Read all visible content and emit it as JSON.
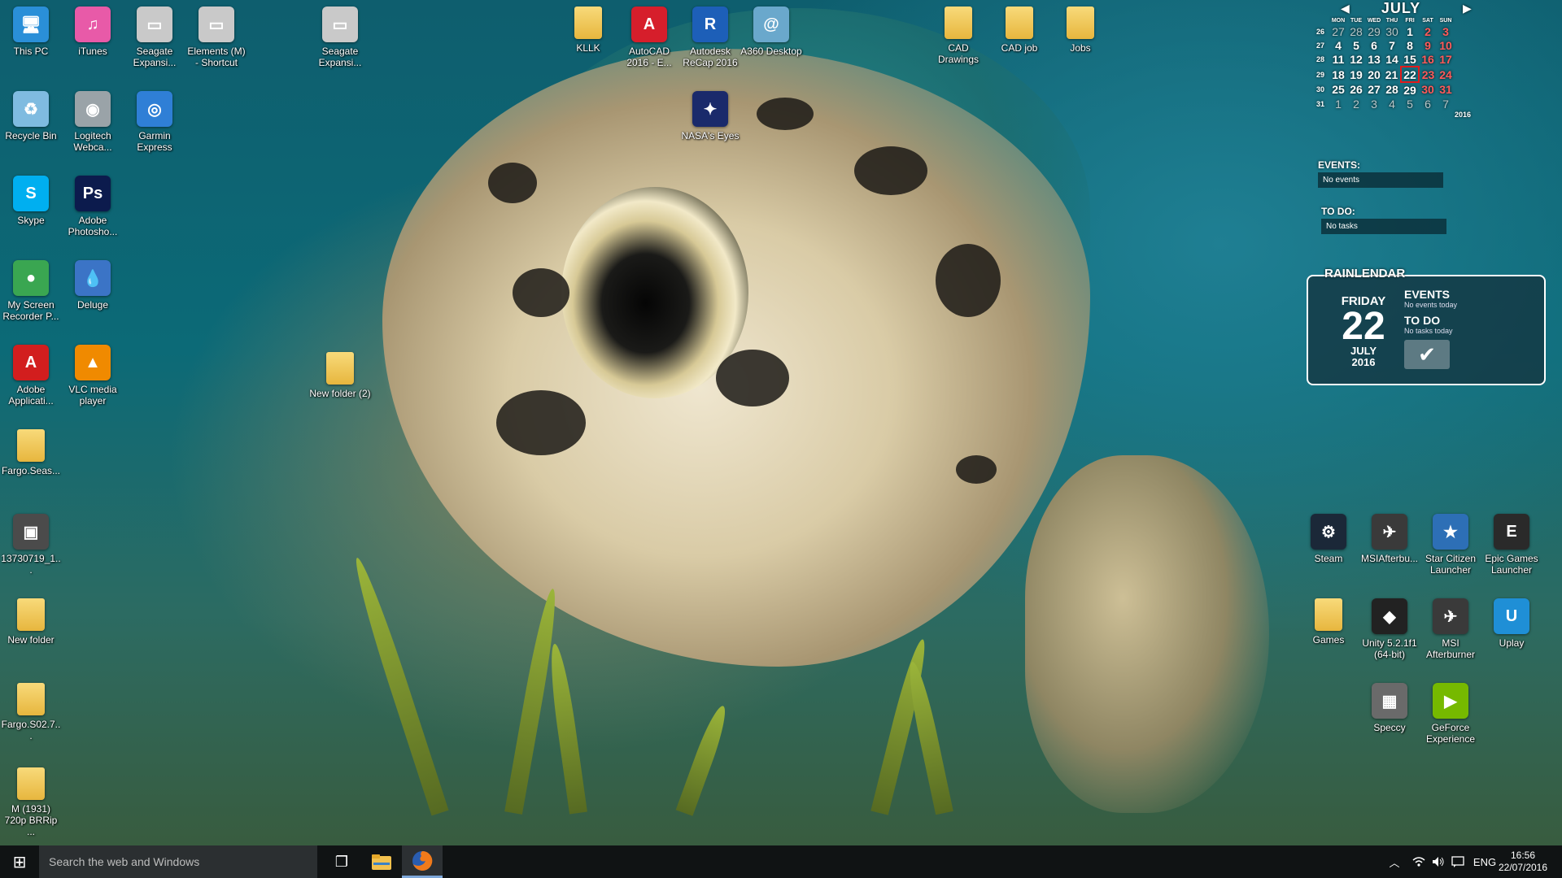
{
  "desktop": {
    "icons": [
      {
        "label": "This PC",
        "icon": "computer-icon",
        "color": "#2a8fd8"
      },
      {
        "label": "iTunes",
        "icon": "itunes-icon",
        "color": "#e85aa8"
      },
      {
        "label": "Seagate Expansi...",
        "icon": "drive-icon",
        "color": "#c9c9c9"
      },
      {
        "label": "Elements (M) - Shortcut",
        "icon": "drive-icon",
        "color": "#c9c9c9"
      },
      {
        "label": "Seagate Expansi...",
        "icon": "drive-icon",
        "color": "#c9c9c9"
      },
      {
        "label": "Recycle Bin",
        "icon": "recycle-bin-icon",
        "color": "#7fbbe0"
      },
      {
        "label": "Logitech Webca...",
        "icon": "webcam-icon",
        "color": "#9aa3a8"
      },
      {
        "label": "Garmin Express",
        "icon": "garmin-icon",
        "color": "#2f7fd6"
      },
      {
        "label": "Skype",
        "icon": "skype-icon",
        "color": "#00aff0"
      },
      {
        "label": "Adobe Photosho...",
        "icon": "photoshop-icon",
        "color": "#0c1b4d"
      },
      {
        "label": "My Screen Recorder P...",
        "icon": "screen-recorder-icon",
        "color": "#3aa651"
      },
      {
        "label": "Deluge",
        "icon": "deluge-icon",
        "color": "#3b74c6"
      },
      {
        "label": "Adobe Applicati...",
        "icon": "adobe-icon",
        "color": "#d21e1e"
      },
      {
        "label": "VLC media player",
        "icon": "vlc-icon",
        "color": "#f08a00"
      },
      {
        "label": "Fargo.Seas...",
        "icon": "folder-icon",
        "color": "#e7b63e"
      },
      {
        "label": "13730719_1...",
        "icon": "image-file-icon",
        "color": "#4b4b4b"
      },
      {
        "label": "New folder",
        "icon": "folder-icon",
        "color": "#e7b63e"
      },
      {
        "label": "Fargo.S02.7...",
        "icon": "folder-icon",
        "color": "#e7b63e"
      },
      {
        "label": "M (1931) 720p BRRip ...",
        "icon": "folder-icon",
        "color": "#f0e2b0"
      },
      {
        "label": "New folder (2)",
        "icon": "folder-icon",
        "color": "#e7b63e"
      },
      {
        "label": "KLLK",
        "icon": "folder-icon",
        "color": "#e7b63e"
      },
      {
        "label": "AutoCAD 2016 - E...",
        "icon": "autocad-icon",
        "color": "#d61e2b"
      },
      {
        "label": "Autodesk ReCap 2016",
        "icon": "recap-icon",
        "color": "#1d5fb8"
      },
      {
        "label": "A360 Desktop",
        "icon": "a360-icon",
        "color": "#6aa8cc"
      },
      {
        "label": "NASA's Eyes",
        "icon": "nasa-eyes-icon",
        "color": "#1a2a6b"
      },
      {
        "label": "CAD Drawings",
        "icon": "folder-icon",
        "color": "#e7b63e"
      },
      {
        "label": "CAD job",
        "icon": "folder-icon",
        "color": "#e7b63e"
      },
      {
        "label": "Jobs",
        "icon": "folder-icon",
        "color": "#e7b63e"
      },
      {
        "label": "Steam",
        "icon": "steam-icon",
        "color": "#1b2838"
      },
      {
        "label": "MSIAfterbu...",
        "icon": "msi-afterburner-icon",
        "color": "#3a3a3a"
      },
      {
        "label": "Star Citizen Launcher",
        "icon": "star-citizen-icon",
        "color": "#2d6fb6"
      },
      {
        "label": "Epic Games Launcher",
        "icon": "epic-games-icon",
        "color": "#2a2a2a"
      },
      {
        "label": "Games",
        "icon": "folder-icon",
        "color": "#e7b63e"
      },
      {
        "label": "Unity 5.2.1f1 (64-bit)",
        "icon": "unity-icon",
        "color": "#222222"
      },
      {
        "label": "MSI Afterburner",
        "icon": "msi-afterburner-icon",
        "color": "#3a3a3a"
      },
      {
        "label": "Uplay",
        "icon": "uplay-icon",
        "color": "#1f8fd6"
      },
      {
        "label": "Speccy",
        "icon": "speccy-icon",
        "color": "#6a6a6a"
      },
      {
        "label": "GeForce Experience",
        "icon": "geforce-icon",
        "color": "#76b900"
      }
    ]
  },
  "calendar": {
    "month": "JULY",
    "prev_glyph": "◀",
    "next_glyph": "▶",
    "weekday_headers": [
      "MON",
      "TUE",
      "WED",
      "THU",
      "FRI",
      "SAT",
      "SUN"
    ],
    "weeks": [
      {
        "wk": "26",
        "days": [
          "27",
          "28",
          "29",
          "30",
          "1",
          "2",
          "3"
        ]
      },
      {
        "wk": "27",
        "days": [
          "4",
          "5",
          "6",
          "7",
          "8",
          "9",
          "10"
        ]
      },
      {
        "wk": "28",
        "days": [
          "11",
          "12",
          "13",
          "14",
          "15",
          "16",
          "17"
        ]
      },
      {
        "wk": "29",
        "days": [
          "18",
          "19",
          "20",
          "21",
          "22",
          "23",
          "24"
        ]
      },
      {
        "wk": "30",
        "days": [
          "25",
          "26",
          "27",
          "28",
          "29",
          "30",
          "31"
        ]
      },
      {
        "wk": "31",
        "days": [
          "1",
          "2",
          "3",
          "4",
          "5",
          "6",
          "7"
        ]
      }
    ],
    "today": "22",
    "year": "2016",
    "weekend_color": "#ff5a5a"
  },
  "events_box": {
    "heading": "EVENTS:",
    "body": "No events"
  },
  "todo_box": {
    "heading": "TO DO:",
    "body": "No tasks"
  },
  "rainlendar": {
    "title": "RAINLENDAR",
    "weekday": "FRIDAY",
    "day": "22",
    "month": "JULY",
    "year": "2016",
    "events_heading": "EVENTS",
    "events_sub": "No events today",
    "todo_heading": "TO DO",
    "todo_sub": "No tasks today",
    "check_glyph": "✔"
  },
  "taskbar": {
    "start_glyph": "⊞",
    "search_placeholder": "Search the web and Windows",
    "taskview_glyph": "❐",
    "tray_chevron": "︿",
    "tray_icons": [
      "network-icon",
      "volume-icon",
      "action-center-icon"
    ],
    "language": "ENG",
    "time": "16:56",
    "date": "22/07/2016"
  }
}
